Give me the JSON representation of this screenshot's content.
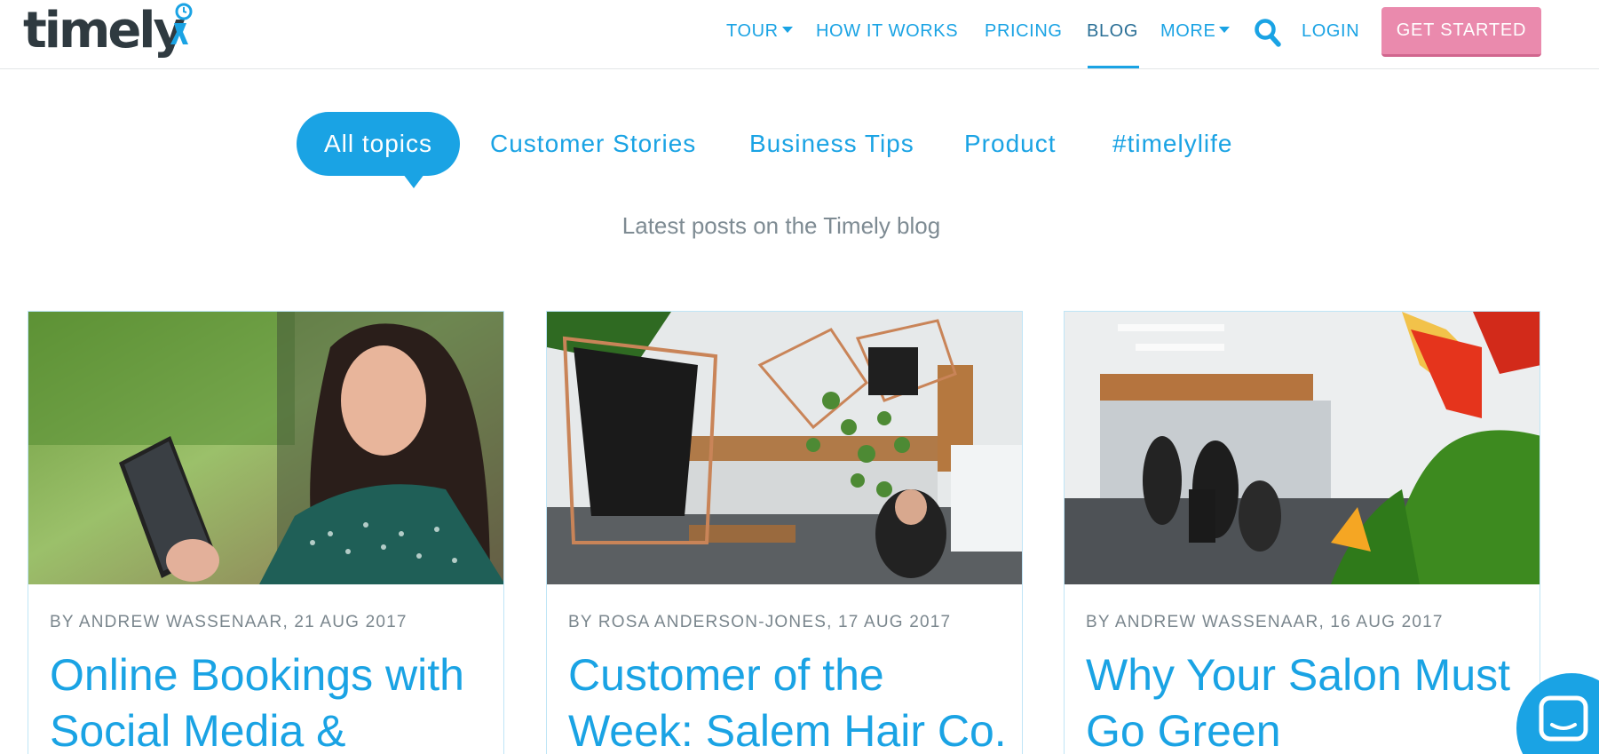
{
  "header": {
    "logo_text": "timely",
    "nav": [
      {
        "label": "TOUR",
        "dropdown": true
      },
      {
        "label": "HOW IT WORKS"
      },
      {
        "label": "PRICING"
      },
      {
        "label": "BLOG",
        "active": true
      },
      {
        "label": "MORE",
        "dropdown": true
      }
    ],
    "search_icon": "search-icon",
    "login_label": "LOGIN",
    "cta_label": "GET STARTED"
  },
  "topics": {
    "active": "All topics",
    "items": [
      "Customer Stories",
      "Business Tips",
      "Product",
      "#timelylife"
    ]
  },
  "subtitle": "Latest posts on the Timely blog",
  "posts": [
    {
      "meta": "BY ANDREW WASSENAAR, 21 AUG 2017",
      "title": "Online Bookings with Social Media &",
      "image": "woman-with-tablet-photo"
    },
    {
      "meta": "BY ROSA ANDERSON-JONES, 17 AUG 2017",
      "title": "Customer of the Week: Salem Hair Co.",
      "image": "salon-plants-photo"
    },
    {
      "meta": "BY ANDREW WASSENAAR, 16 AUG 2017",
      "title": "Why Your Salon Must Go Green",
      "image": "salon-interior-flowers-photo"
    }
  ],
  "chat_icon": "chat-icon",
  "colors": {
    "brand_blue": "#1aa3e4",
    "cta_pink": "#ea8aad",
    "logo_dark": "#2f3a40"
  }
}
